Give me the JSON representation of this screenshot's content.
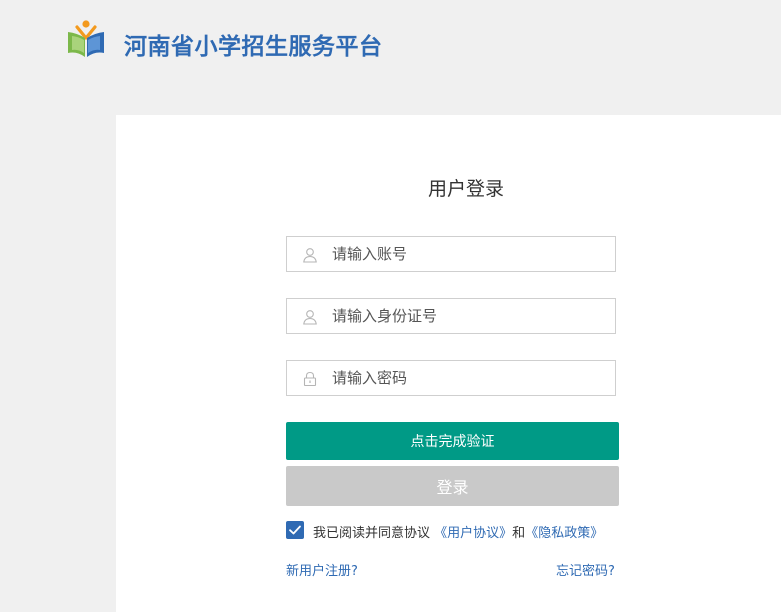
{
  "header": {
    "site_title": "河南省小学招生服务平台"
  },
  "login": {
    "title": "用户登录",
    "account_placeholder": "请输入账号",
    "id_placeholder": "请输入身份证号",
    "password_placeholder": "请输入密码",
    "verify_label": "点击完成验证",
    "login_label": "登录",
    "agree_prefix": "我已阅读并同意协议",
    "user_agreement": "《用户协议》",
    "agree_and": "和",
    "privacy_policy": "《隐私政策》",
    "register_label": "新用户注册?",
    "forgot_label": "忘记密码?"
  },
  "colors": {
    "brand_blue": "#2f6ab3",
    "verify_green": "#009a86",
    "login_disabled_gray": "#c9c9c9"
  },
  "icons": {
    "logo": "book-person-logo",
    "account": "user-icon",
    "id_card": "user-icon",
    "password": "lock-icon",
    "checkbox": "check-icon"
  },
  "state": {
    "agreement_checked": true
  }
}
